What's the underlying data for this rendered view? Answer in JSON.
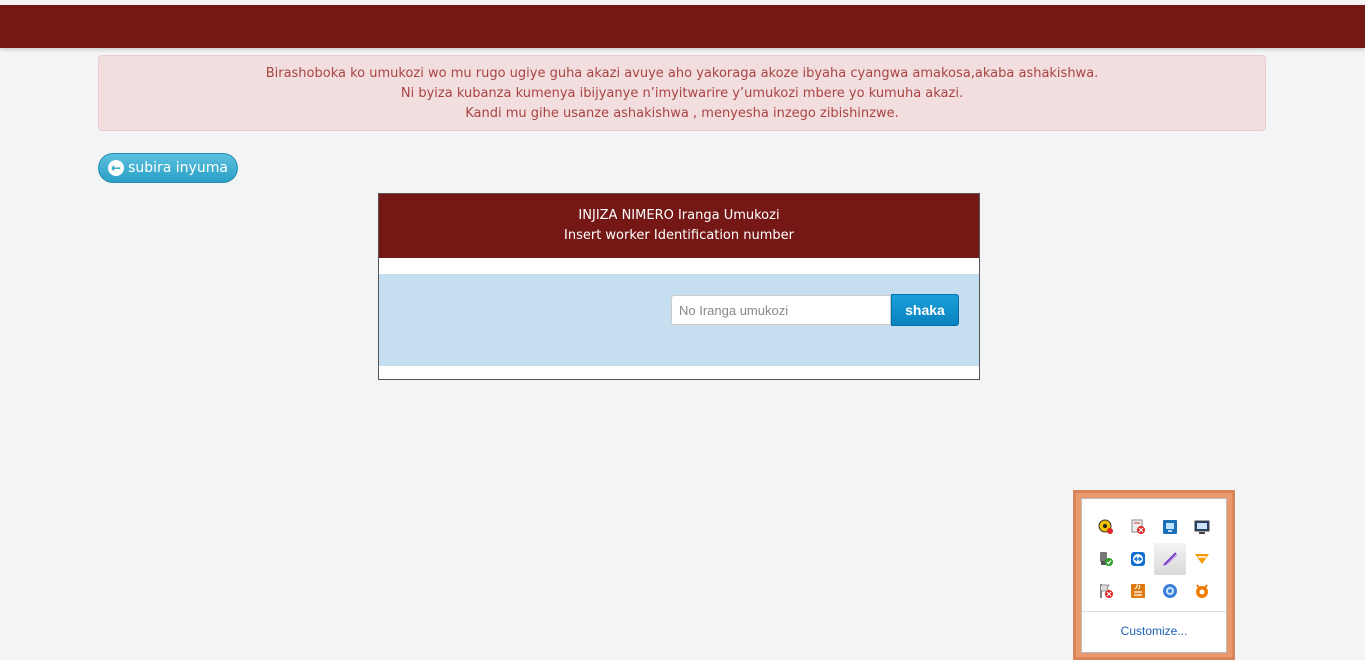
{
  "alert": {
    "lines": [
      "Birashoboka ko umukozi wo mu rugo ugiye guha akazi avuye aho yakoraga akoze ibyaha cyangwa amakosa,akaba ashakishwa.",
      "Ni byiza kubanza kumenya ibijyanye n’imyitwarire y’umukozi mbere yo kumuha akazi.",
      "Kandi mu gihe usanze ashakishwa , menyesha inzego zibishinzwe."
    ]
  },
  "back_button": {
    "label": "subira inyuma",
    "icon": "arrow-left-icon"
  },
  "panel": {
    "title_line1": "INJIZA NIMERO Iranga Umukozi",
    "title_line2": "Insert worker Identification number",
    "input": {
      "placeholder": "No Iranga umukozi",
      "value": ""
    },
    "search_label": "shaka"
  },
  "tray": {
    "icons": [
      "yellow-circle-icon",
      "red-x-app-icon",
      "blue-network-icon",
      "monitor-icon",
      "usb-safe-remove-icon",
      "teamviewer-icon",
      "pen-tablet-icon",
      "vlc-cone-icon",
      "flag-error-icon",
      "java-icon",
      "circle-app-icon",
      "avast-icon"
    ],
    "customize_label": "Customize..."
  },
  "colors": {
    "header": "#741715",
    "alert_bg": "#f2dedf",
    "alert_text": "#a94442",
    "panel_body": "#c6dff0",
    "primary_button": "#0a82c0",
    "back_button": "#2aa0c6"
  }
}
